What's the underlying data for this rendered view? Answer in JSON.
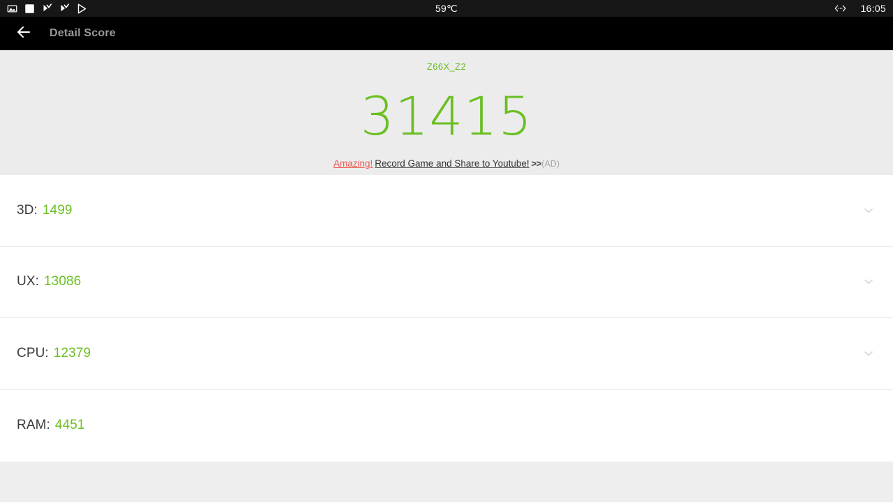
{
  "statusbar": {
    "temperature": "59℃",
    "time": "16:05",
    "left_icons": [
      {
        "name": "gallery-image-icon"
      },
      {
        "name": "white-square-icon"
      },
      {
        "name": "play-check-flag-icon"
      },
      {
        "name": "play-check-flag-icon"
      },
      {
        "name": "play-store-icon"
      }
    ],
    "right_icons": [
      {
        "name": "ethernet-network-icon"
      }
    ]
  },
  "appbar": {
    "back_icon": "back-arrow-icon",
    "title": "Detail Score"
  },
  "score_panel": {
    "device_name": "Z66X_Z2",
    "total_score": "31415",
    "ad": {
      "highlight": "Amazing!",
      "body": "Record Game and Share to Youtube!",
      "arrows": ">>",
      "tag": "(AD)"
    }
  },
  "list": {
    "rows": [
      {
        "label": "3D:",
        "value": "1499",
        "chevron": "chevron-down-icon",
        "has_chevron": true
      },
      {
        "label": "UX:",
        "value": "13086",
        "chevron": "chevron-down-icon",
        "has_chevron": true
      },
      {
        "label": "CPU:",
        "value": "12379",
        "chevron": "chevron-down-icon",
        "has_chevron": true
      },
      {
        "label": "RAM:",
        "value": "4451",
        "chevron": "chevron-down-icon",
        "has_chevron": false
      }
    ]
  },
  "colors": {
    "accent_green": "#6abf22",
    "ad_red": "#ee5a52",
    "panel_gray": "#ececec",
    "page_bg": "#eeeeee",
    "appbar_black": "#000000"
  }
}
